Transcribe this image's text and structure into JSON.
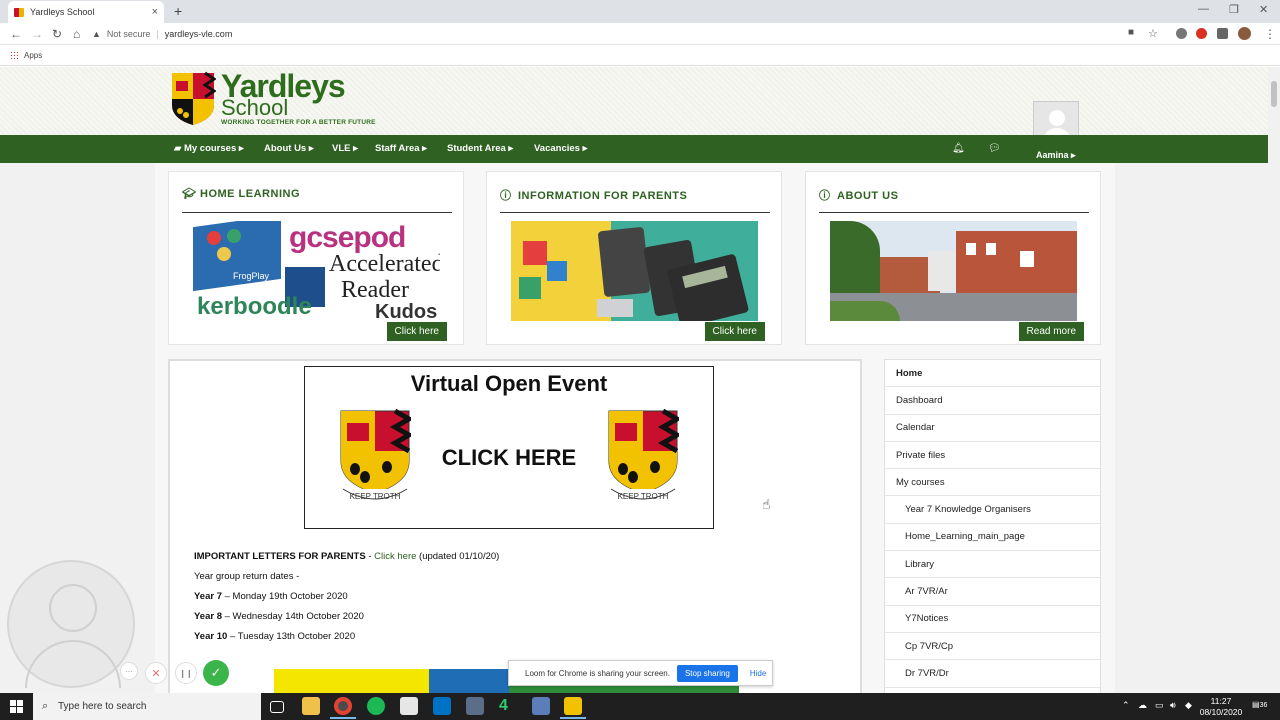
{
  "browser": {
    "tab_title": "Yardleys School",
    "tab_close": "×",
    "new_tab": "+",
    "security": "Not secure",
    "url": "yardleys-vle.com",
    "bookmarks_apps": "Apps",
    "window_min": "—",
    "window_restore": "❐",
    "window_close": "✕"
  },
  "site": {
    "logo_line1": "Yardleys",
    "logo_line2": "School",
    "logo_tagline": "WORKING TOGETHER FOR A BETTER FUTURE",
    "crest_motto": "KEEP TROTH",
    "nav": [
      {
        "label": "My courses ▸"
      },
      {
        "label": "About Us ▸"
      },
      {
        "label": "VLE ▸"
      },
      {
        "label": "Staff Area ▸"
      },
      {
        "label": "Student Area ▸"
      },
      {
        "label": "Vacancies ▸"
      }
    ],
    "username": "Aamina ▸"
  },
  "cards": [
    {
      "title": "HOME LEARNING",
      "icon": "graduation-cap-icon",
      "button": "Click here",
      "img_texts": [
        "gcsepod",
        "Accelerated",
        "Reader",
        "kerboodle",
        "Kudos",
        "FrogPlay"
      ]
    },
    {
      "title": "INFORMATION FOR PARENTS",
      "icon": "info-icon",
      "button": "Click here"
    },
    {
      "title": "ABOUT US",
      "icon": "info-icon",
      "button": "Read more"
    }
  ],
  "main": {
    "banner_title": "Virtual Open Event",
    "banner_click": "CLICK HERE",
    "letters_label": "IMPORTANT LETTERS FOR PARENTS",
    "letters_dash": " - ",
    "letters_link": "Click here",
    "letters_updated": " (updated 01/10/20)",
    "return_dates_label": "Year group return dates -",
    "years": [
      {
        "year": "Year 7",
        "date": " – Monday 19th October 2020"
      },
      {
        "year": "Year 8",
        "date": " – Wednesday 14th October 2020"
      },
      {
        "year": "Year 10",
        "date": " – Tuesday 13th October 2020"
      }
    ]
  },
  "sidenav": [
    {
      "label": "Home",
      "bold": true,
      "sub": false
    },
    {
      "label": "Dashboard",
      "bold": false,
      "sub": false
    },
    {
      "label": "Calendar",
      "bold": false,
      "sub": false
    },
    {
      "label": "Private files",
      "bold": false,
      "sub": false
    },
    {
      "label": "My courses",
      "bold": false,
      "sub": false
    },
    {
      "label": "Year 7 Knowledge Organisers",
      "bold": false,
      "sub": true
    },
    {
      "label": "Home_Learning_main_page",
      "bold": false,
      "sub": true
    },
    {
      "label": "Library",
      "bold": false,
      "sub": true
    },
    {
      "label": "Ar 7VR/Ar",
      "bold": false,
      "sub": true
    },
    {
      "label": "Y7Notices",
      "bold": false,
      "sub": true
    },
    {
      "label": "Cp 7VR/Cp",
      "bold": false,
      "sub": true
    },
    {
      "label": "Dr 7VR/Dr",
      "bold": false,
      "sub": true
    }
  ],
  "loom": {
    "share_text": "Loom for Chrome is sharing your screen.",
    "stop_label": "Stop sharing",
    "hide_label": "Hide",
    "more": "···",
    "cancel": "✕",
    "pause": "❙❙",
    "done": "✓"
  },
  "taskbar": {
    "search_placeholder": "Type here to search",
    "time": "11:27",
    "date": "08/10/2020",
    "notif_count": "36"
  },
  "colors": {
    "brand_green": "#2e6122",
    "crest_red": "#c8102e",
    "crest_yellow": "#f2c200"
  }
}
